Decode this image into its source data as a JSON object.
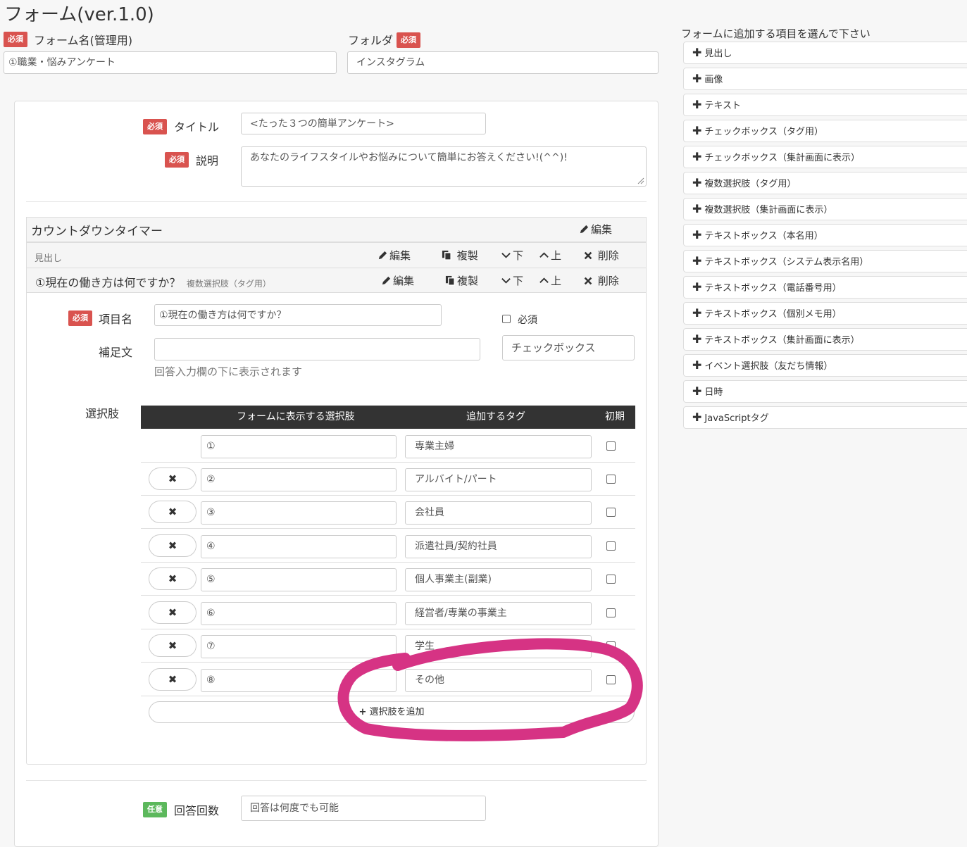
{
  "page": {
    "title": "フォーム(ver.1.0)",
    "required_badge": "必須",
    "optional_badge": "任意"
  },
  "form_meta": {
    "form_name_label": "フォーム名(管理用)",
    "form_name_value": "①職業・悩みアンケート",
    "folder_label": "フォルダ",
    "folder_value": "インスタグラム"
  },
  "form_settings": {
    "title_label": "タイトル",
    "title_value": "<たった３つの簡単アンケート>",
    "description_label": "説明",
    "description_value": "あなたのライフスタイルやお悩みについて簡単にお答えください!(^^)!"
  },
  "countdown": {
    "label": "カウントダウンタイマー",
    "edit": "編集"
  },
  "actions": {
    "edit": "編集",
    "duplicate": "複製",
    "down": "下",
    "up": "上",
    "delete": "削除"
  },
  "heading_block": {
    "label": "見出し"
  },
  "question": {
    "title": "①現在の働き方は何ですか？",
    "type_label": "複数選択肢（タグ用）",
    "item_name_label": "項目名",
    "item_name_value": "①現在の働き方は何ですか？",
    "required_checkbox_label": "必須",
    "supplement_label": "補足文",
    "supplement_value": "",
    "supplement_help": "回答入力欄の下に表示されます",
    "input_type": "チェックボックス",
    "choices_label": "選択肢",
    "table_headers": {
      "choice": "フォームに表示する選択肢",
      "tag": "追加するタグ",
      "initial": "初期"
    },
    "choices": [
      {
        "number": "①",
        "tag": "専業主婦"
      },
      {
        "number": "②",
        "tag": "アルバイト/パート"
      },
      {
        "number": "③",
        "tag": "会社員"
      },
      {
        "number": "④",
        "tag": "派遣社員/契約社員"
      },
      {
        "number": "⑤",
        "tag": "個人事業主(副業)"
      },
      {
        "number": "⑥",
        "tag": "経営者/専業の事業主"
      },
      {
        "number": "⑦",
        "tag": "学生"
      },
      {
        "number": "⑧",
        "tag": "その他"
      }
    ],
    "delete_glyph": "✖",
    "add_choice_label": "選択肢を追加"
  },
  "answer_count": {
    "label": "回答回数",
    "value": "回答は何度でも可能"
  },
  "right_panel": {
    "heading": "フォームに追加する項目を選んで下さい",
    "items": [
      "見出し",
      "画像",
      "テキスト",
      "チェックボックス（タグ用）",
      "チェックボックス（集計画面に表示）",
      "複数選択肢（タグ用）",
      "複数選択肢（集計画面に表示）",
      "テキストボックス（本名用）",
      "テキストボックス（システム表示名用）",
      "テキストボックス（電話番号用）",
      "テキストボックス（個別メモ用）",
      "テキストボックス（集計画面に表示）",
      "イベント選択肢（友だち情報）",
      "日時",
      "JavaScriptタグ"
    ]
  },
  "colors": {
    "required_red": "#d9534f",
    "optional_green": "#5cb85c",
    "annotation_pink": "#d63384",
    "table_header": "#333333"
  }
}
